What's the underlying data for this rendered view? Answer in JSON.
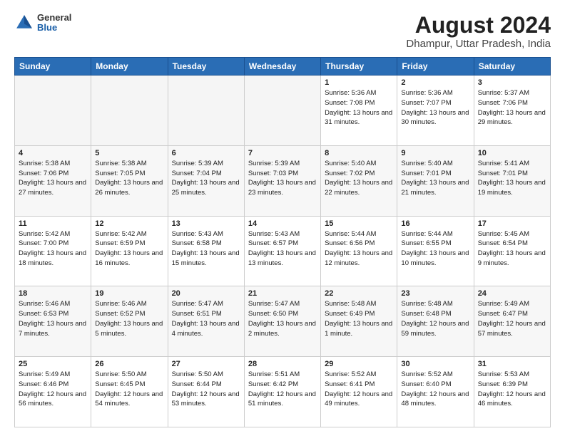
{
  "header": {
    "logo_general": "General",
    "logo_blue": "Blue",
    "main_title": "August 2024",
    "subtitle": "Dhampur, Uttar Pradesh, India"
  },
  "days_of_week": [
    "Sunday",
    "Monday",
    "Tuesday",
    "Wednesday",
    "Thursday",
    "Friday",
    "Saturday"
  ],
  "weeks": [
    [
      {
        "day": "",
        "empty": true
      },
      {
        "day": "",
        "empty": true
      },
      {
        "day": "",
        "empty": true
      },
      {
        "day": "",
        "empty": true
      },
      {
        "day": "1",
        "sunrise": "5:36 AM",
        "sunset": "7:08 PM",
        "daylight": "13 hours and 31 minutes."
      },
      {
        "day": "2",
        "sunrise": "5:36 AM",
        "sunset": "7:07 PM",
        "daylight": "13 hours and 30 minutes."
      },
      {
        "day": "3",
        "sunrise": "5:37 AM",
        "sunset": "7:06 PM",
        "daylight": "13 hours and 29 minutes."
      }
    ],
    [
      {
        "day": "4",
        "sunrise": "5:38 AM",
        "sunset": "7:06 PM",
        "daylight": "13 hours and 27 minutes."
      },
      {
        "day": "5",
        "sunrise": "5:38 AM",
        "sunset": "7:05 PM",
        "daylight": "13 hours and 26 minutes."
      },
      {
        "day": "6",
        "sunrise": "5:39 AM",
        "sunset": "7:04 PM",
        "daylight": "13 hours and 25 minutes."
      },
      {
        "day": "7",
        "sunrise": "5:39 AM",
        "sunset": "7:03 PM",
        "daylight": "13 hours and 23 minutes."
      },
      {
        "day": "8",
        "sunrise": "5:40 AM",
        "sunset": "7:02 PM",
        "daylight": "13 hours and 22 minutes."
      },
      {
        "day": "9",
        "sunrise": "5:40 AM",
        "sunset": "7:01 PM",
        "daylight": "13 hours and 21 minutes."
      },
      {
        "day": "10",
        "sunrise": "5:41 AM",
        "sunset": "7:01 PM",
        "daylight": "13 hours and 19 minutes."
      }
    ],
    [
      {
        "day": "11",
        "sunrise": "5:42 AM",
        "sunset": "7:00 PM",
        "daylight": "13 hours and 18 minutes."
      },
      {
        "day": "12",
        "sunrise": "5:42 AM",
        "sunset": "6:59 PM",
        "daylight": "13 hours and 16 minutes."
      },
      {
        "day": "13",
        "sunrise": "5:43 AM",
        "sunset": "6:58 PM",
        "daylight": "13 hours and 15 minutes."
      },
      {
        "day": "14",
        "sunrise": "5:43 AM",
        "sunset": "6:57 PM",
        "daylight": "13 hours and 13 minutes."
      },
      {
        "day": "15",
        "sunrise": "5:44 AM",
        "sunset": "6:56 PM",
        "daylight": "13 hours and 12 minutes."
      },
      {
        "day": "16",
        "sunrise": "5:44 AM",
        "sunset": "6:55 PM",
        "daylight": "13 hours and 10 minutes."
      },
      {
        "day": "17",
        "sunrise": "5:45 AM",
        "sunset": "6:54 PM",
        "daylight": "13 hours and 9 minutes."
      }
    ],
    [
      {
        "day": "18",
        "sunrise": "5:46 AM",
        "sunset": "6:53 PM",
        "daylight": "13 hours and 7 minutes."
      },
      {
        "day": "19",
        "sunrise": "5:46 AM",
        "sunset": "6:52 PM",
        "daylight": "13 hours and 5 minutes."
      },
      {
        "day": "20",
        "sunrise": "5:47 AM",
        "sunset": "6:51 PM",
        "daylight": "13 hours and 4 minutes."
      },
      {
        "day": "21",
        "sunrise": "5:47 AM",
        "sunset": "6:50 PM",
        "daylight": "13 hours and 2 minutes."
      },
      {
        "day": "22",
        "sunrise": "5:48 AM",
        "sunset": "6:49 PM",
        "daylight": "13 hours and 1 minute."
      },
      {
        "day": "23",
        "sunrise": "5:48 AM",
        "sunset": "6:48 PM",
        "daylight": "12 hours and 59 minutes."
      },
      {
        "day": "24",
        "sunrise": "5:49 AM",
        "sunset": "6:47 PM",
        "daylight": "12 hours and 57 minutes."
      }
    ],
    [
      {
        "day": "25",
        "sunrise": "5:49 AM",
        "sunset": "6:46 PM",
        "daylight": "12 hours and 56 minutes."
      },
      {
        "day": "26",
        "sunrise": "5:50 AM",
        "sunset": "6:45 PM",
        "daylight": "12 hours and 54 minutes."
      },
      {
        "day": "27",
        "sunrise": "5:50 AM",
        "sunset": "6:44 PM",
        "daylight": "12 hours and 53 minutes."
      },
      {
        "day": "28",
        "sunrise": "5:51 AM",
        "sunset": "6:42 PM",
        "daylight": "12 hours and 51 minutes."
      },
      {
        "day": "29",
        "sunrise": "5:52 AM",
        "sunset": "6:41 PM",
        "daylight": "12 hours and 49 minutes."
      },
      {
        "day": "30",
        "sunrise": "5:52 AM",
        "sunset": "6:40 PM",
        "daylight": "12 hours and 48 minutes."
      },
      {
        "day": "31",
        "sunrise": "5:53 AM",
        "sunset": "6:39 PM",
        "daylight": "12 hours and 46 minutes."
      }
    ]
  ]
}
